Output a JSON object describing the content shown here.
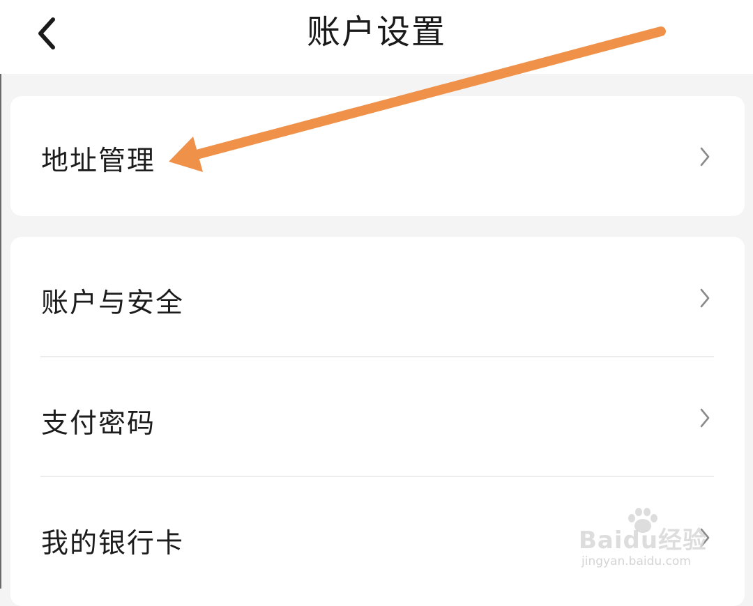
{
  "header": {
    "title": "账户设置",
    "back_icon": "chevron-left-icon"
  },
  "address_card": {
    "items": [
      {
        "label": "地址管理",
        "icon": "chevron-right-icon"
      }
    ]
  },
  "account_card": {
    "items": [
      {
        "label": "账户与安全",
        "icon": "chevron-right-icon"
      },
      {
        "label": "支付密码",
        "icon": "chevron-right-icon"
      },
      {
        "label": "我的银行卡",
        "icon": "chevron-right-icon"
      }
    ]
  },
  "annotation": {
    "arrow_color": "#f0914a",
    "points_to": "地址管理"
  },
  "watermark": {
    "brand": "Baidu经验",
    "url": "jingyan.baidu.com"
  },
  "colors": {
    "page_background": "#f4f4f4",
    "card_background": "#ffffff",
    "text": "#1c1c1c",
    "chevron": "#8a8a8a",
    "divider": "#ececec"
  }
}
